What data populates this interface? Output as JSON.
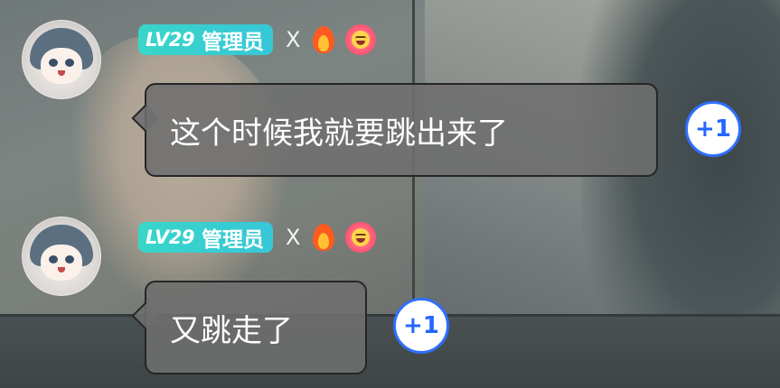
{
  "messages": [
    {
      "level": "LV29",
      "role": "管理员",
      "x_mark": "X",
      "icons": [
        "fire-icon",
        "smiling-flower-icon"
      ],
      "text": "这个时候我就要跳出来了",
      "plus_one": "+1"
    },
    {
      "level": "LV29",
      "role": "管理员",
      "x_mark": "X",
      "icons": [
        "fire-icon",
        "smiling-flower-icon"
      ],
      "text": "又跳走了",
      "plus_one": "+1"
    }
  ],
  "colors": {
    "level_badge": "#38d6c8",
    "bubble_bg": "#6e6e6e",
    "bubble_border": "#262626",
    "plus_one_border": "#2f6fff",
    "plus_one_text": "#2466ff"
  }
}
